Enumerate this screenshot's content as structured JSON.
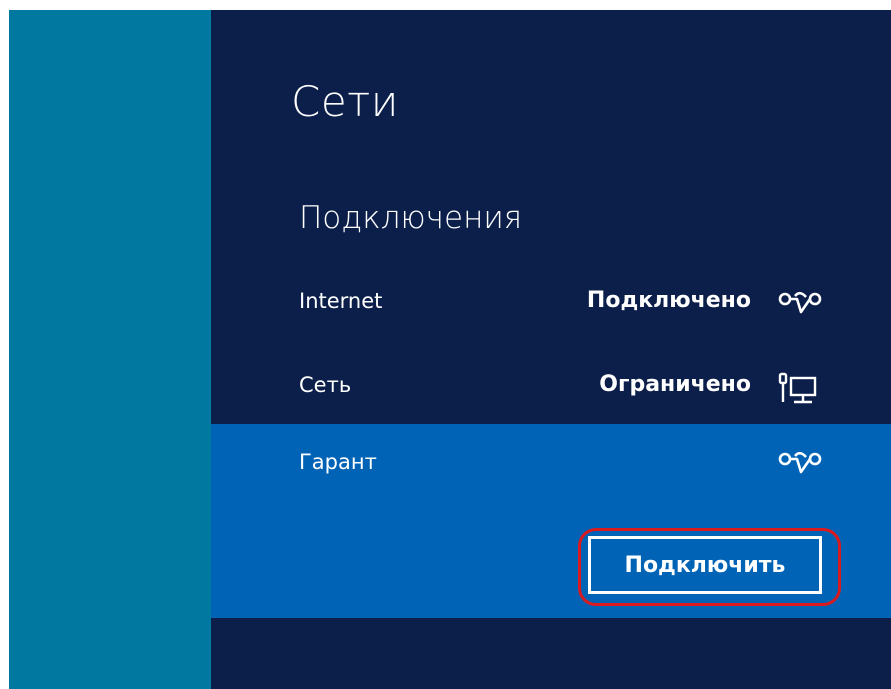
{
  "panel": {
    "title": "Сети",
    "section_title": "Подключения"
  },
  "connections": [
    {
      "name": "Internet",
      "status": "Подключено",
      "icon": "vpn-link-icon"
    },
    {
      "name": "Сеть",
      "status": "Ограничено",
      "icon": "wired-network-icon"
    },
    {
      "name": "Гарант",
      "status": "",
      "icon": "vpn-link-icon"
    }
  ],
  "selected": {
    "button_label": "Подключить"
  },
  "colors": {
    "left_strip": "#00789f",
    "panel_bg": "#0b1f4a",
    "selected_row": "#0063b6",
    "highlight_ring": "#d91a1f"
  }
}
